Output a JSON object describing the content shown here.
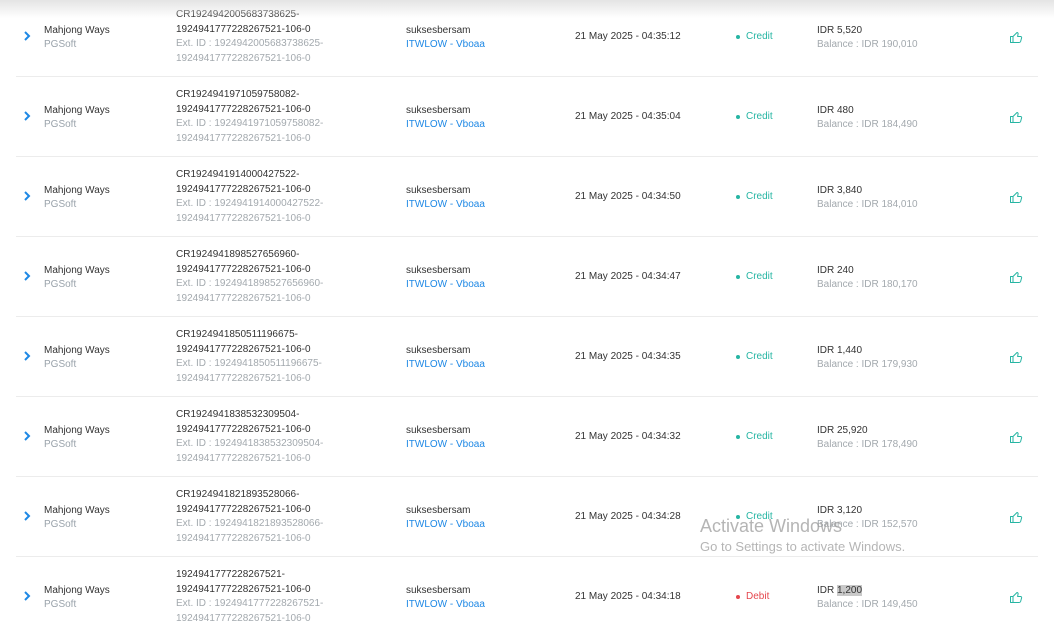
{
  "colors": {
    "credit": "#26b5a3",
    "debit": "#e5464d",
    "link": "#1e88e5",
    "muted": "#a3a9ae"
  },
  "transactions": [
    {
      "game": "Mahjong Ways",
      "provider": "PGSoft",
      "txn_line1": "CR1924942005683738625-",
      "txn_line2": "1924941777228267521-106-0",
      "ext_line1": "Ext. ID : 1924942005683738625-",
      "ext_line2": "1924941777228267521-106-0",
      "user": "suksesbersam",
      "operator": "ITWLOW - Vboaa",
      "datetime": "21 May 2025 - 04:35:12",
      "type": "Credit",
      "amount": "IDR 5,520",
      "balance": "Balance : IDR 190,010"
    },
    {
      "game": "Mahjong Ways",
      "provider": "PGSoft",
      "txn_line1": "CR1924941971059758082-",
      "txn_line2": "1924941777228267521-106-0",
      "ext_line1": "Ext. ID : 1924941971059758082-",
      "ext_line2": "1924941777228267521-106-0",
      "user": "suksesbersam",
      "operator": "ITWLOW - Vboaa",
      "datetime": "21 May 2025 - 04:35:04",
      "type": "Credit",
      "amount": "IDR 480",
      "balance": "Balance : IDR 184,490"
    },
    {
      "game": "Mahjong Ways",
      "provider": "PGSoft",
      "txn_line1": "CR1924941914000427522-",
      "txn_line2": "1924941777228267521-106-0",
      "ext_line1": "Ext. ID : 1924941914000427522-",
      "ext_line2": "1924941777228267521-106-0",
      "user": "suksesbersam",
      "operator": "ITWLOW - Vboaa",
      "datetime": "21 May 2025 - 04:34:50",
      "type": "Credit",
      "amount": "IDR 3,840",
      "balance": "Balance : IDR 184,010"
    },
    {
      "game": "Mahjong Ways",
      "provider": "PGSoft",
      "txn_line1": "CR1924941898527656960-",
      "txn_line2": "1924941777228267521-106-0",
      "ext_line1": "Ext. ID : 1924941898527656960-",
      "ext_line2": "1924941777228267521-106-0",
      "user": "suksesbersam",
      "operator": "ITWLOW - Vboaa",
      "datetime": "21 May 2025 - 04:34:47",
      "type": "Credit",
      "amount": "IDR 240",
      "balance": "Balance : IDR 180,170"
    },
    {
      "game": "Mahjong Ways",
      "provider": "PGSoft",
      "txn_line1": "CR1924941850511196675-",
      "txn_line2": "1924941777228267521-106-0",
      "ext_line1": "Ext. ID : 1924941850511196675-",
      "ext_line2": "1924941777228267521-106-0",
      "user": "suksesbersam",
      "operator": "ITWLOW - Vboaa",
      "datetime": "21 May 2025 - 04:34:35",
      "type": "Credit",
      "amount": "IDR 1,440",
      "balance": "Balance : IDR 179,930"
    },
    {
      "game": "Mahjong Ways",
      "provider": "PGSoft",
      "txn_line1": "CR1924941838532309504-",
      "txn_line2": "1924941777228267521-106-0",
      "ext_line1": "Ext. ID : 1924941838532309504-",
      "ext_line2": "1924941777228267521-106-0",
      "user": "suksesbersam",
      "operator": "ITWLOW - Vboaa",
      "datetime": "21 May 2025 - 04:34:32",
      "type": "Credit",
      "amount": "IDR 25,920",
      "balance": "Balance : IDR 178,490"
    },
    {
      "game": "Mahjong Ways",
      "provider": "PGSoft",
      "txn_line1": "CR1924941821893528066-",
      "txn_line2": "1924941777228267521-106-0",
      "ext_line1": "Ext. ID : 1924941821893528066-",
      "ext_line2": "1924941777228267521-106-0",
      "user": "suksesbersam",
      "operator": "ITWLOW - Vboaa",
      "datetime": "21 May 2025 - 04:34:28",
      "type": "Credit",
      "amount": "IDR 3,120",
      "balance": "Balance : IDR 152,570"
    },
    {
      "game": "Mahjong Ways",
      "provider": "PGSoft",
      "txn_line1": "1924941777228267521-",
      "txn_line2": "1924941777228267521-106-0",
      "ext_line1": "Ext. ID : 1924941777228267521-",
      "ext_line2": "1924941777228267521-106-0",
      "user": "suksesbersam",
      "operator": "ITWLOW - Vboaa",
      "datetime": "21 May 2025 - 04:34:18",
      "type": "Debit",
      "amount_prefix": "IDR ",
      "amount_highlight": "1,200",
      "balance": "Balance : IDR 149,450"
    }
  ],
  "watermark": {
    "line1": "Activate Windows",
    "line2": "Go to Settings to activate Windows."
  }
}
